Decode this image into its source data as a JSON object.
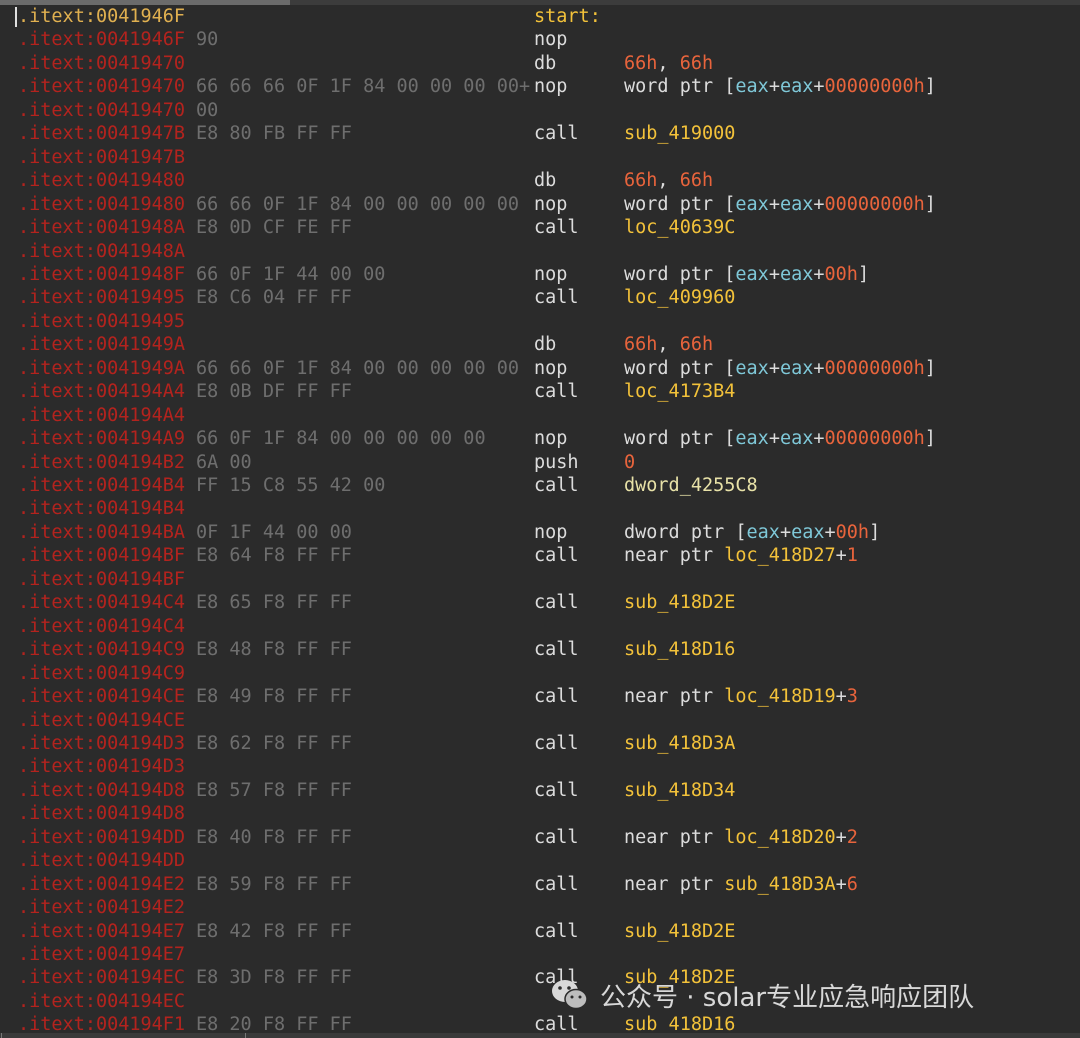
{
  "colors": {
    "background": "#2b2b2b",
    "address": "#b3231e",
    "bytes": "#6e6e6e",
    "mnemonic": "#dcdcdc",
    "name": "#f3c23a",
    "number": "#e8643c",
    "register": "#7fc8d8",
    "data_ref": "#e8e2a8"
  },
  "rows": [
    {
      "addr": ".itext:0041946F",
      "bytes": "",
      "label": "start:",
      "mnem": "",
      "ops": []
    },
    {
      "addr": ".itext:0041946F",
      "bytes": "90",
      "mnem": "nop",
      "ops": []
    },
    {
      "addr": ".itext:00419470",
      "bytes": "",
      "mnem": "db",
      "ops": [
        {
          "t": "num",
          "v": "66h"
        },
        {
          "t": "plain",
          "v": ", "
        },
        {
          "t": "num",
          "v": "66h"
        }
      ]
    },
    {
      "addr": ".itext:00419470",
      "bytes": "66 66 66 0F 1F 84 00 00 00 00+",
      "mnem": "nop",
      "ops": [
        {
          "t": "plain",
          "v": "word ptr ["
        },
        {
          "t": "reg",
          "v": "eax"
        },
        {
          "t": "plain",
          "v": "+"
        },
        {
          "t": "reg",
          "v": "eax"
        },
        {
          "t": "plain",
          "v": "+"
        },
        {
          "t": "num",
          "v": "00000000h"
        },
        {
          "t": "plain",
          "v": "]"
        }
      ]
    },
    {
      "addr": ".itext:00419470",
      "bytes": "00",
      "mnem": "",
      "ops": []
    },
    {
      "addr": ".itext:0041947B",
      "bytes": "E8 80 FB FF FF",
      "mnem": "call",
      "ops": [
        {
          "t": "name",
          "v": "sub_419000"
        }
      ]
    },
    {
      "addr": ".itext:0041947B",
      "bytes": "",
      "mnem": "",
      "ops": []
    },
    {
      "addr": ".itext:00419480",
      "bytes": "",
      "mnem": "db",
      "ops": [
        {
          "t": "num",
          "v": "66h"
        },
        {
          "t": "plain",
          "v": ", "
        },
        {
          "t": "num",
          "v": "66h"
        }
      ]
    },
    {
      "addr": ".itext:00419480",
      "bytes": "66 66 0F 1F 84 00 00 00 00 00",
      "mnem": "nop",
      "ops": [
        {
          "t": "plain",
          "v": "word ptr ["
        },
        {
          "t": "reg",
          "v": "eax"
        },
        {
          "t": "plain",
          "v": "+"
        },
        {
          "t": "reg",
          "v": "eax"
        },
        {
          "t": "plain",
          "v": "+"
        },
        {
          "t": "num",
          "v": "00000000h"
        },
        {
          "t": "plain",
          "v": "]"
        }
      ]
    },
    {
      "addr": ".itext:0041948A",
      "bytes": "E8 0D CF FE FF",
      "mnem": "call",
      "ops": [
        {
          "t": "name",
          "v": "loc_40639C"
        }
      ]
    },
    {
      "addr": ".itext:0041948A",
      "bytes": "",
      "mnem": "",
      "ops": []
    },
    {
      "addr": ".itext:0041948F",
      "bytes": "66 0F 1F 44 00 00",
      "mnem": "nop",
      "ops": [
        {
          "t": "plain",
          "v": "word ptr ["
        },
        {
          "t": "reg",
          "v": "eax"
        },
        {
          "t": "plain",
          "v": "+"
        },
        {
          "t": "reg",
          "v": "eax"
        },
        {
          "t": "plain",
          "v": "+"
        },
        {
          "t": "num",
          "v": "00h"
        },
        {
          "t": "plain",
          "v": "]"
        }
      ]
    },
    {
      "addr": ".itext:00419495",
      "bytes": "E8 C6 04 FF FF",
      "mnem": "call",
      "ops": [
        {
          "t": "name",
          "v": "loc_409960"
        }
      ]
    },
    {
      "addr": ".itext:00419495",
      "bytes": "",
      "mnem": "",
      "ops": []
    },
    {
      "addr": ".itext:0041949A",
      "bytes": "",
      "mnem": "db",
      "ops": [
        {
          "t": "num",
          "v": "66h"
        },
        {
          "t": "plain",
          "v": ", "
        },
        {
          "t": "num",
          "v": "66h"
        }
      ]
    },
    {
      "addr": ".itext:0041949A",
      "bytes": "66 66 0F 1F 84 00 00 00 00 00",
      "mnem": "nop",
      "ops": [
        {
          "t": "plain",
          "v": "word ptr ["
        },
        {
          "t": "reg",
          "v": "eax"
        },
        {
          "t": "plain",
          "v": "+"
        },
        {
          "t": "reg",
          "v": "eax"
        },
        {
          "t": "plain",
          "v": "+"
        },
        {
          "t": "num",
          "v": "00000000h"
        },
        {
          "t": "plain",
          "v": "]"
        }
      ]
    },
    {
      "addr": ".itext:004194A4",
      "bytes": "E8 0B DF FF FF",
      "mnem": "call",
      "ops": [
        {
          "t": "name",
          "v": "loc_4173B4"
        }
      ]
    },
    {
      "addr": ".itext:004194A4",
      "bytes": "",
      "mnem": "",
      "ops": []
    },
    {
      "addr": ".itext:004194A9",
      "bytes": "66 0F 1F 84 00 00 00 00 00",
      "mnem": "nop",
      "ops": [
        {
          "t": "plain",
          "v": "word ptr ["
        },
        {
          "t": "reg",
          "v": "eax"
        },
        {
          "t": "plain",
          "v": "+"
        },
        {
          "t": "reg",
          "v": "eax"
        },
        {
          "t": "plain",
          "v": "+"
        },
        {
          "t": "num",
          "v": "00000000h"
        },
        {
          "t": "plain",
          "v": "]"
        }
      ]
    },
    {
      "addr": ".itext:004194B2",
      "bytes": "6A 00",
      "mnem": "push",
      "ops": [
        {
          "t": "num",
          "v": "0"
        }
      ]
    },
    {
      "addr": ".itext:004194B4",
      "bytes": "FF 15 C8 55 42 00",
      "mnem": "call",
      "ops": [
        {
          "t": "data",
          "v": "dword_4255C8"
        }
      ]
    },
    {
      "addr": ".itext:004194B4",
      "bytes": "",
      "mnem": "",
      "ops": []
    },
    {
      "addr": ".itext:004194BA",
      "bytes": "0F 1F 44 00 00",
      "mnem": "nop",
      "ops": [
        {
          "t": "plain",
          "v": "dword ptr ["
        },
        {
          "t": "reg",
          "v": "eax"
        },
        {
          "t": "plain",
          "v": "+"
        },
        {
          "t": "reg",
          "v": "eax"
        },
        {
          "t": "plain",
          "v": "+"
        },
        {
          "t": "num",
          "v": "00h"
        },
        {
          "t": "plain",
          "v": "]"
        }
      ]
    },
    {
      "addr": ".itext:004194BF",
      "bytes": "E8 64 F8 FF FF",
      "mnem": "call",
      "ops": [
        {
          "t": "plain",
          "v": "near ptr "
        },
        {
          "t": "name",
          "v": "loc_418D27"
        },
        {
          "t": "plain",
          "v": "+"
        },
        {
          "t": "num",
          "v": "1"
        }
      ]
    },
    {
      "addr": ".itext:004194BF",
      "bytes": "",
      "mnem": "",
      "ops": []
    },
    {
      "addr": ".itext:004194C4",
      "bytes": "E8 65 F8 FF FF",
      "mnem": "call",
      "ops": [
        {
          "t": "name",
          "v": "sub_418D2E"
        }
      ]
    },
    {
      "addr": ".itext:004194C4",
      "bytes": "",
      "mnem": "",
      "ops": []
    },
    {
      "addr": ".itext:004194C9",
      "bytes": "E8 48 F8 FF FF",
      "mnem": "call",
      "ops": [
        {
          "t": "name",
          "v": "sub_418D16"
        }
      ]
    },
    {
      "addr": ".itext:004194C9",
      "bytes": "",
      "mnem": "",
      "ops": []
    },
    {
      "addr": ".itext:004194CE",
      "bytes": "E8 49 F8 FF FF",
      "mnem": "call",
      "ops": [
        {
          "t": "plain",
          "v": "near ptr "
        },
        {
          "t": "name",
          "v": "loc_418D19"
        },
        {
          "t": "plain",
          "v": "+"
        },
        {
          "t": "num",
          "v": "3"
        }
      ]
    },
    {
      "addr": ".itext:004194CE",
      "bytes": "",
      "mnem": "",
      "ops": []
    },
    {
      "addr": ".itext:004194D3",
      "bytes": "E8 62 F8 FF FF",
      "mnem": "call",
      "ops": [
        {
          "t": "name",
          "v": "sub_418D3A"
        }
      ]
    },
    {
      "addr": ".itext:004194D3",
      "bytes": "",
      "mnem": "",
      "ops": []
    },
    {
      "addr": ".itext:004194D8",
      "bytes": "E8 57 F8 FF FF",
      "mnem": "call",
      "ops": [
        {
          "t": "name",
          "v": "sub_418D34"
        }
      ]
    },
    {
      "addr": ".itext:004194D8",
      "bytes": "",
      "mnem": "",
      "ops": []
    },
    {
      "addr": ".itext:004194DD",
      "bytes": "E8 40 F8 FF FF",
      "mnem": "call",
      "ops": [
        {
          "t": "plain",
          "v": "near ptr "
        },
        {
          "t": "name",
          "v": "loc_418D20"
        },
        {
          "t": "plain",
          "v": "+"
        },
        {
          "t": "num",
          "v": "2"
        }
      ]
    },
    {
      "addr": ".itext:004194DD",
      "bytes": "",
      "mnem": "",
      "ops": []
    },
    {
      "addr": ".itext:004194E2",
      "bytes": "E8 59 F8 FF FF",
      "mnem": "call",
      "ops": [
        {
          "t": "plain",
          "v": "near ptr "
        },
        {
          "t": "name",
          "v": "sub_418D3A"
        },
        {
          "t": "plain",
          "v": "+"
        },
        {
          "t": "num",
          "v": "6"
        }
      ]
    },
    {
      "addr": ".itext:004194E2",
      "bytes": "",
      "mnem": "",
      "ops": []
    },
    {
      "addr": ".itext:004194E7",
      "bytes": "E8 42 F8 FF FF",
      "mnem": "call",
      "ops": [
        {
          "t": "name",
          "v": "sub_418D2E"
        }
      ]
    },
    {
      "addr": ".itext:004194E7",
      "bytes": "",
      "mnem": "",
      "ops": []
    },
    {
      "addr": ".itext:004194EC",
      "bytes": "E8 3D F8 FF FF",
      "mnem": "call",
      "ops": [
        {
          "t": "name",
          "v": "sub_418D2E"
        }
      ]
    },
    {
      "addr": ".itext:004194EC",
      "bytes": "",
      "mnem": "",
      "ops": []
    },
    {
      "addr": ".itext:004194F1",
      "bytes": "E8 20 F8 FF FF",
      "mnem": "call",
      "ops": [
        {
          "t": "name",
          "v": "sub_418D16"
        }
      ]
    }
  ],
  "watermark": {
    "text": "公众号 · solar专业应急响应团队",
    "icon": "wechat-icon"
  }
}
